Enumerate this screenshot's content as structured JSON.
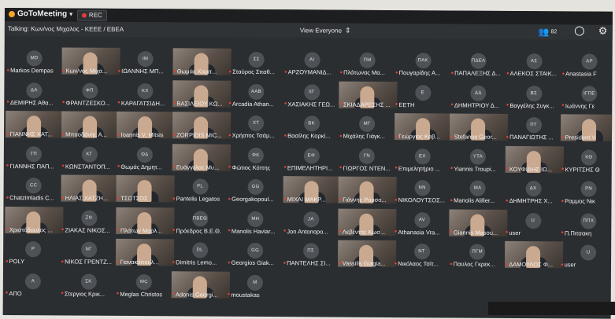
{
  "app": {
    "brand": "GoToMeeting",
    "rec_label": "REC",
    "talking": "Talking: Κων/νος Μιχαλος - ΚΕΕΕ / ΕΒΕΑ",
    "view_mode": "View Everyone",
    "participant_count": "82"
  },
  "colors": {
    "background": "#2b2e31",
    "rec_dot": "#e23b3b",
    "muted_mic": "#e8403a",
    "brand_orange": "#f5a623"
  },
  "tiles": [
    {
      "name": "Markos Dempas",
      "initials": "MD",
      "video": false
    },
    {
      "name": "Κων/νος Μιχα...",
      "initials": "",
      "video": true
    },
    {
      "name": "ΙΩΑΝΝΗΣ ΜΠ...",
      "initials": "IM",
      "video": false
    },
    {
      "name": "Θωμάς Χαριτ...",
      "initials": "",
      "video": true
    },
    {
      "name": "Σταύρος Σπαθ...",
      "initials": "ΣΣ",
      "video": false
    },
    {
      "name": "ΑΡΖΟΥΜΑΝΙΔ...",
      "initials": "AI",
      "video": false
    },
    {
      "name": "Πλάτωνας Μα...",
      "initials": "ΠΜ",
      "video": false
    },
    {
      "name": "Πουγαρίδης Α...",
      "initials": "ΠΑΚ",
      "video": false
    },
    {
      "name": "ΠΑΠΑΛΕΞΗΣ Δ...",
      "initials": "ΠΔΕΛ",
      "video": false
    },
    {
      "name": "ΑΛΕΚΟΣ ΣΤΑΙΚ...",
      "initials": "ΑΣ",
      "video": false
    },
    {
      "name": "Anastasia F",
      "initials": "AP",
      "video": false
    },
    {
      "name": "ΔΕΜΙΡΗΣ Αθα...",
      "initials": "ΔΑ",
      "video": false
    },
    {
      "name": "ΦΡΑΝΤΖΕΣΚΟ...",
      "initials": "ΦΠ",
      "video": false
    },
    {
      "name": "ΚΑΡΑΓΑΤΣΙΔΗ...",
      "initials": "ΚΧ",
      "video": false
    },
    {
      "name": "ΒΑΣΙΛΕΙΟΥ ΚΩ...",
      "initials": "",
      "video": true
    },
    {
      "name": "Arcadia Athan...",
      "initials": "AAB",
      "video": false
    },
    {
      "name": "ΧΑΣΙΑΚΗΣ ΓΕΩ...",
      "initials": "ΧΓ",
      "video": false
    },
    {
      "name": "ΣΚΙΑΔΑΡΕΣΗΣ ...",
      "initials": "",
      "video": true
    },
    {
      "name": "EETH",
      "initials": "E",
      "video": false
    },
    {
      "name": "ΔΗΜΗΤΡΙΟΥ Δ...",
      "initials": "ΔΔ",
      "video": false
    },
    {
      "name": "Βαγγέλης Συγκ...",
      "initials": "ΒΣ",
      "video": false
    },
    {
      "name": "Ιωάννης Γε",
      "initials": "ΙΓΠΕ",
      "video": false
    },
    {
      "name": "ΓΙΑΝΝΗΣ ΧΑΤ...",
      "initials": "",
      "video": true
    },
    {
      "name": "Μπαοδάνης Α...",
      "initials": "",
      "video": true
    },
    {
      "name": "Ioannis V. Mitsis",
      "initials": "",
      "video": true
    },
    {
      "name": "ZORPIDIS MIC...",
      "initials": "",
      "video": true
    },
    {
      "name": "Χρήστος Τσάμ...",
      "initials": "ΧΤ",
      "video": false
    },
    {
      "name": "Βασίλης Κορκί...",
      "initials": "ΒΚ",
      "video": false
    },
    {
      "name": "Μιχάλης Γιάγκ...",
      "initials": "ΜΓ",
      "video": false
    },
    {
      "name": "Γεώργιος Καβ...",
      "initials": "",
      "video": true
    },
    {
      "name": "Stefanos Geor...",
      "initials": "",
      "video": true
    },
    {
      "name": "ΠΑΝΑΓΙΩΤΗΣ ...",
      "initials": "ΠΤ",
      "video": false
    },
    {
      "name": "President V",
      "initials": "",
      "video": true
    },
    {
      "name": "ΓΙΑΝΝΗΣ ΠΑΠ...",
      "initials": "ΓΠ",
      "video": false
    },
    {
      "name": "ΚΩΝΣΤΑΝΤΟΠ...",
      "initials": "ΚΓ",
      "video": false
    },
    {
      "name": "Θωμάς Δημητ...",
      "initials": "ΘΔ",
      "video": false
    },
    {
      "name": "Ευάγγελος Μυ...",
      "initials": "",
      "video": true
    },
    {
      "name": "Φώτιος Κόττης",
      "initials": "ΦΚ",
      "video": false
    },
    {
      "name": "ΕΠΙΜΕΛΗΤΗΡΙ...",
      "initials": "ΕΦ",
      "video": false
    },
    {
      "name": "ΓΙΩΡΓΟΣ ΝΤΕΝ...",
      "initials": "ΓΝ",
      "video": false
    },
    {
      "name": "Επιμελητήριο ...",
      "initials": "ΕΧ",
      "video": false
    },
    {
      "name": "Yiannis Troupi...",
      "initials": "YTA",
      "video": false
    },
    {
      "name": "ΚΟΥΦΙΔΗΣ ΙΩ...",
      "initials": "",
      "video": true
    },
    {
      "name": "ΚΥΡΙΤΣΗΣ Θ",
      "initials": "ΚΘ",
      "video": false
    },
    {
      "name": "Chatzimladis C...",
      "initials": "CC",
      "video": false
    },
    {
      "name": "ΗΛΙΑΣ ΧΑΤΖΗ...",
      "initials": "",
      "video": true
    },
    {
      "name": "ΤΣΩΤΣΟΣ",
      "initials": "",
      "video": true
    },
    {
      "name": "Pantelis Legatos",
      "initials": "PL",
      "video": false
    },
    {
      "name": "Georgakopoul...",
      "initials": "GG",
      "video": false
    },
    {
      "name": "ΜΙΧΑΙ ΜΑΚΡ...",
      "initials": "",
      "video": true
    },
    {
      "name": "Γιάννης Ρουσο...",
      "initials": "",
      "video": true
    },
    {
      "name": "ΝΙΚΟΛΟΥΤΣΟΣ...",
      "initials": "NN",
      "video": false
    },
    {
      "name": "Manolis Alifier...",
      "initials": "MA",
      "video": false
    },
    {
      "name": "ΔΗΜΗΤΡΗΣ Χ...",
      "initials": "ΔΧ",
      "video": false
    },
    {
      "name": "Ραμμος Νικ",
      "initials": "PN",
      "video": false
    },
    {
      "name": "Χριστόδουλος ...",
      "initials": "",
      "video": true
    },
    {
      "name": "ΖΙΑΚΑΣ ΝΙΚΟΣ...",
      "initials": "ZN",
      "video": false
    },
    {
      "name": "Πλάτων Μαρλ...",
      "initials": "",
      "video": true
    },
    {
      "name": "Πρόεδρος Β.Ε.Θ.",
      "initials": "ΠΒΕΘ",
      "video": false
    },
    {
      "name": "Manolis Haviar...",
      "initials": "MH",
      "video": false
    },
    {
      "name": "Jon Antonopo...",
      "initials": "JA",
      "video": false
    },
    {
      "name": "Λεβέντης Κωσ...",
      "initials": "",
      "video": true
    },
    {
      "name": "Athanasia Vra...",
      "initials": "AV",
      "video": false
    },
    {
      "name": "Giannis Masou...",
      "initials": "",
      "video": true
    },
    {
      "name": "user",
      "initials": "U",
      "video": false
    },
    {
      "name": "Π.Πιτσακη",
      "initials": "ΠΠΧ",
      "video": false
    },
    {
      "name": "POLY",
      "initials": "P",
      "video": false
    },
    {
      "name": "ΝΙΚΟΣ ΓΡΕΝΤΖ...",
      "initials": "ΝΓ",
      "video": false
    },
    {
      "name": "Γιανακόπουλ...",
      "initials": "",
      "video": true
    },
    {
      "name": "Dimitris Lemo...",
      "initials": "DL",
      "video": false
    },
    {
      "name": "Georgios Giak...",
      "initials": "GG",
      "video": false
    },
    {
      "name": "ΠΑΝΤΕΛΗΣ ΣΙ...",
      "initials": "ΠΣ",
      "video": false
    },
    {
      "name": "Vassilis Giagia...",
      "initials": "",
      "video": true
    },
    {
      "name": "Νικόλαος Τσίτ...",
      "initials": "NT",
      "video": false
    },
    {
      "name": "Παυλος Γκρεκ...",
      "initials": "ΠΓΜ",
      "video": false
    },
    {
      "name": "ΔΑΜΟΥΛΟΣ Φ...",
      "initials": "",
      "video": true
    },
    {
      "name": "user",
      "initials": "U",
      "video": false
    },
    {
      "name": "ΑΠΟ",
      "initials": "A",
      "video": false
    },
    {
      "name": "Στεργιος Κρικ...",
      "initials": "ΣΚ",
      "video": false
    },
    {
      "name": "Meglas Christos",
      "initials": "MC",
      "video": false
    },
    {
      "name": "Adonis Georgi...",
      "initials": "",
      "video": true
    },
    {
      "name": "moustakas",
      "initials": "M",
      "video": false
    }
  ]
}
